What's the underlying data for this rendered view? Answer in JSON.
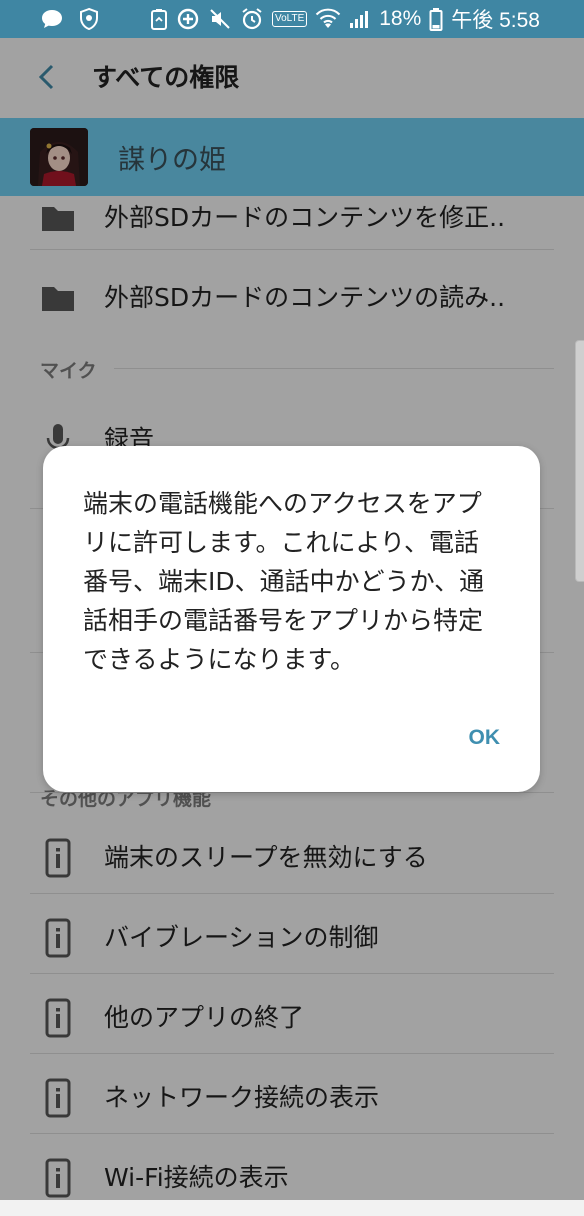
{
  "status_bar": {
    "battery_percent": "18%",
    "time": "午後 5:58",
    "volte": "VoLTE",
    "icons": [
      "chat-bubble-icon",
      "shield-icon",
      "recycle-icon",
      "data-saver-icon",
      "mute-icon",
      "alarm-icon",
      "volte-icon",
      "wifi-icon",
      "signal-icon",
      "battery-icon"
    ]
  },
  "header": {
    "title": "すべての権限",
    "back_icon": "back-arrow-icon"
  },
  "app": {
    "name": "謀りの姫",
    "header_color": "#6ec9ec"
  },
  "permissions": [
    {
      "icon": "folder-icon",
      "label": "外部SDカードのコンテンツを修正.."
    },
    {
      "icon": "folder-icon",
      "label": "外部SDカードのコンテンツの読み.."
    }
  ],
  "sections": [
    {
      "title": "マイク",
      "items": [
        {
          "icon": "microphone-icon",
          "label": "録音"
        }
      ]
    },
    {
      "title": "その他のアプリ機能",
      "items": [
        {
          "icon": "info-device-icon",
          "label": "端末のスリープを無効にする"
        },
        {
          "icon": "info-device-icon",
          "label": "バイブレーションの制御"
        },
        {
          "icon": "info-device-icon",
          "label": "他のアプリの終了"
        },
        {
          "icon": "info-device-icon",
          "label": "ネットワーク接続の表示"
        },
        {
          "icon": "info-device-icon",
          "label": "Wi-Fi接続の表示"
        }
      ]
    }
  ],
  "dialog": {
    "lines": [
      "端末の電話機能へのアクセスをアプ",
      "リに許可します。これにより、電話",
      "番号、端末ID、通話中かどうか、通",
      "話相手の電話番号をアプリから特定",
      "できるようになります。"
    ],
    "ok_label": "OK"
  },
  "colors": {
    "status_bar": "#3f86a3",
    "accent": "#3f8fb0",
    "background": "#f2f2f2"
  }
}
